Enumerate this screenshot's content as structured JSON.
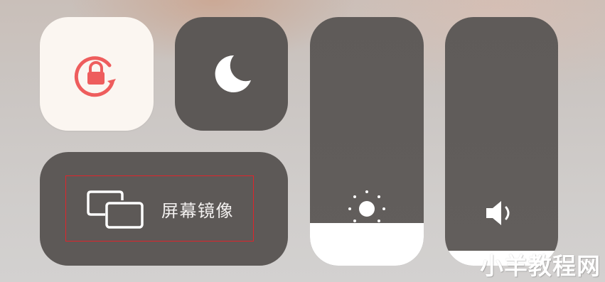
{
  "control_center": {
    "screen_mirroring": {
      "label": "屏幕镜像",
      "icon": "screen-mirroring-icon"
    },
    "rotation_lock": {
      "icon": "rotation-lock-icon",
      "state": "on",
      "accent_color": "#ee5d5d"
    },
    "do_not_disturb": {
      "icon": "moon-icon",
      "state": "off"
    },
    "brightness": {
      "icon": "sun-icon",
      "level_percent": 17
    },
    "volume": {
      "icon": "speaker-icon",
      "level_percent": 6
    }
  },
  "annotation": {
    "highlight_color": "#e0242b"
  },
  "watermark": {
    "text": "小羊教程网"
  }
}
